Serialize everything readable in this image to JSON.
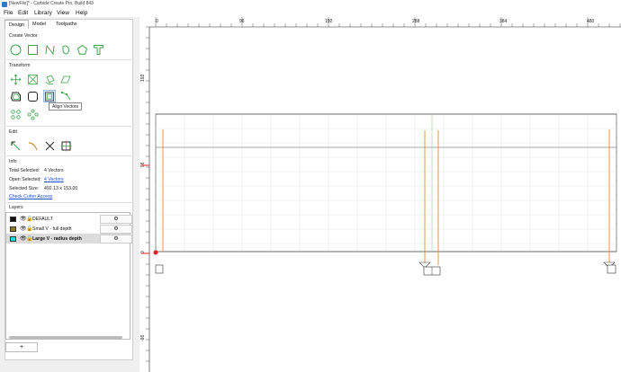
{
  "window": {
    "title": "[NewFile]* - Carbide Create Pro, Build 843"
  },
  "menu": [
    {
      "label": "File",
      "underline": "F"
    },
    {
      "label": "Edit",
      "underline": "E"
    },
    {
      "label": "Library",
      "underline": ""
    },
    {
      "label": "View",
      "underline": ""
    },
    {
      "label": "Help",
      "underline": "H"
    }
  ],
  "tabs": [
    "Design",
    "Model",
    "Toolpaths"
  ],
  "sections": {
    "create_vector": "Create Vector",
    "transform": "Transform",
    "edit": "Edit",
    "info": "Info",
    "layers": "Layers"
  },
  "tooltip": "Align Vectors",
  "info": {
    "total_selected_label": "Total Selected:",
    "total_selected_value": "4 Vectors",
    "open_selected_label": "Open Selected:",
    "open_selected_value": "4 Vectors",
    "selected_size_label": "Selected Size:",
    "selected_size_value": "492.13 x 153.00",
    "check_cutter": "Check Cutter Access"
  },
  "layers": [
    {
      "name": "DEFAULT",
      "color": "#111111",
      "selected": false,
      "bold": false
    },
    {
      "name": "Small V - full depth",
      "color": "#8a7a2a",
      "selected": false,
      "bold": false
    },
    {
      "name": "Large V - radius depth",
      "color": "#2ed3e0",
      "selected": true,
      "bold": true
    }
  ],
  "add_layer_label": "+",
  "ruler": {
    "top_labels": [
      "0",
      "96",
      "192",
      "288",
      "384",
      "480"
    ],
    "left_labels": [
      "192",
      "96",
      "0",
      "-96"
    ]
  },
  "colors": {
    "accent_green": "#3aa84a",
    "toolpath_orange": "#f08a24",
    "selection_blue": "#1a4fd6"
  }
}
